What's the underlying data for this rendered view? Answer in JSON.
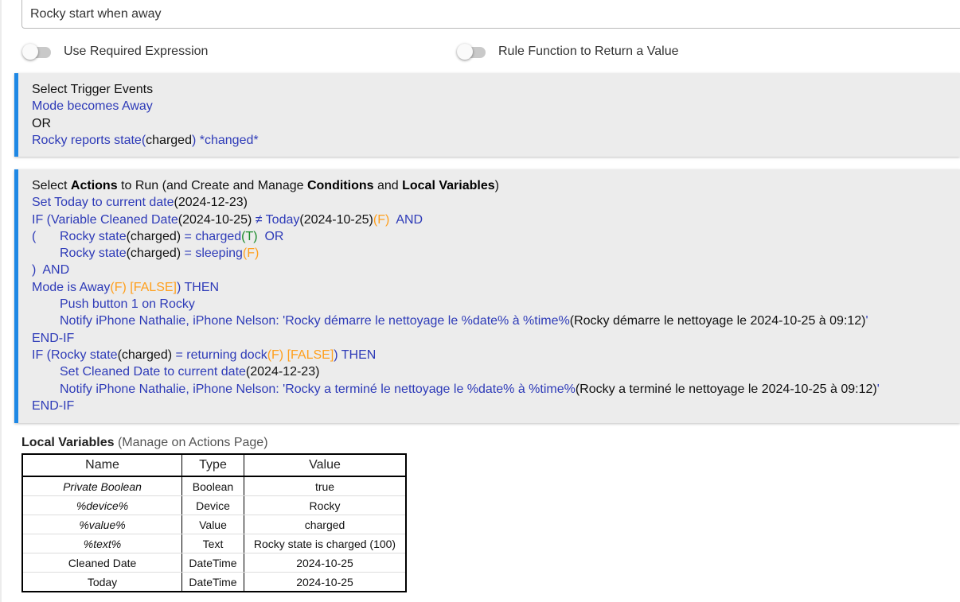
{
  "rule_name": "Rocky start when away",
  "toggles": [
    {
      "label": "Use Required Expression",
      "on": false
    },
    {
      "label": "Rule Function to Return a Value",
      "on": false
    }
  ],
  "triggers": {
    "header": "Select Trigger Events",
    "mode": "Mode becomes Away",
    "or": "OR",
    "rocky_prefix": "Rocky reports state(",
    "rocky_attr": "charged",
    "rocky_suffix": ") *changed*"
  },
  "actions": {
    "header_select": "Select ",
    "header_actions": "Actions",
    "header_mid1": " to Run (and Create and Manage ",
    "header_conditions": "Conditions",
    "header_and": " and ",
    "header_localvars": "Local Variables",
    "header_close": ")",
    "l1_a": "Set Today to current date",
    "l1_b": "(2024-12-23)",
    "l2_a": "IF (Variable Cleaned Date",
    "l2_b": "(2024-10-25)",
    "l2_c": " ≠ Today",
    "l2_d": "(2024-10-25)",
    "l2_e": "(F)",
    "l2_f": "  AND",
    "l3_paren": "(",
    "l3_a": "Rocky state",
    "l3_b": "(charged)",
    "l3_c": " = charged",
    "l3_d": "(T)",
    "l3_e": "  OR",
    "l4_a": "Rocky state",
    "l4_b": "(charged)",
    "l4_c": " = sleeping",
    "l4_d": "(F)",
    "l5_a": ")  AND",
    "l6_a": "Mode is Away",
    "l6_b": "(F) [FALSE]",
    "l6_c": ") THEN",
    "l7_a": "Push button 1 on Rocky",
    "l8_a": "Notify iPhone Nathalie, iPhone Nelson: 'Rocky démarre le nettoyage le %date% à %time%",
    "l8_b": "(Rocky démarre le nettoyage le 2024-10-25 à 09:12)",
    "l8_c": "'",
    "l9_a": "END-IF",
    "l10_a": "IF (Rocky state",
    "l10_b": "(charged)",
    "l10_c": " = returning dock",
    "l10_d": "(F) [FALSE]",
    "l10_e": ") THEN",
    "l11_a": "Set Cleaned Date to current date",
    "l11_b": "(2024-12-23)",
    "l12_a": "Notify iPhone Nathalie, iPhone Nelson: 'Rocky a terminé le nettoyage le %date% à %time%",
    "l12_b": "(Rocky a terminé le nettoyage le 2024-10-25 à 09:12)",
    "l12_c": "'",
    "l13_a": "END-IF"
  },
  "local_vars": {
    "title_bold": "Local Variables",
    "title_rest": " (Manage on Actions Page)",
    "headers": [
      "Name",
      "Type",
      "Value"
    ],
    "rows": [
      {
        "name": "Private Boolean",
        "type": "Boolean",
        "value": "true"
      },
      {
        "name": "%device%",
        "type": "Device",
        "value": "Rocky"
      },
      {
        "name": "%value%",
        "type": "Value",
        "value": "charged"
      },
      {
        "name": "%text%",
        "type": "Text",
        "value": "Rocky state is charged (100)"
      },
      {
        "name": "Cleaned Date",
        "type": "DateTime",
        "value": "2024-10-25"
      },
      {
        "name": "Today",
        "type": "DateTime",
        "value": "2024-10-25"
      }
    ]
  },
  "colors": {
    "accent": "#1e88e5",
    "link_blue": "#2e3bb8",
    "false_orange": "#ff9f1c",
    "true_green": "#1a8a2a",
    "panel_bg": "#ececec"
  }
}
